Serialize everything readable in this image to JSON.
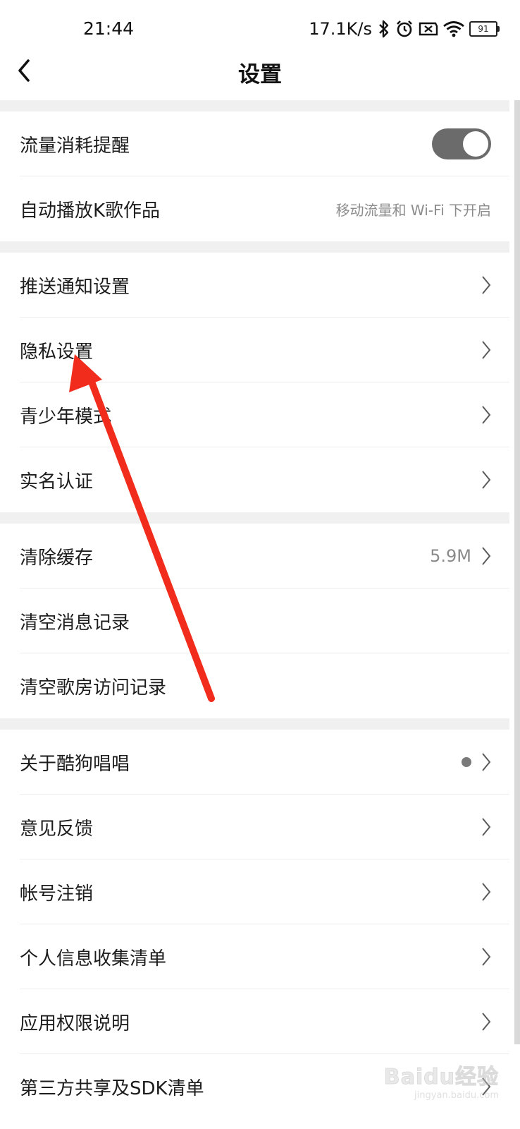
{
  "status_bar": {
    "time": "21:44",
    "network_speed": "17.1K/s",
    "battery_level": "91",
    "icons": [
      "bluetooth-icon",
      "alarm-icon",
      "sim-error-icon",
      "wifi-icon",
      "battery-icon"
    ]
  },
  "navbar": {
    "title": "设置",
    "back_icon": "chevron-left-icon"
  },
  "groups": [
    {
      "rows": [
        {
          "label": "流量消耗提醒",
          "control": "toggle",
          "toggle_on": true
        },
        {
          "label": "自动播放K歌作品",
          "value": "移动流量和 Wi-Fi 下开启"
        }
      ]
    },
    {
      "rows": [
        {
          "label": "推送通知设置"
        },
        {
          "label": "隐私设置"
        },
        {
          "label": "青少年模式"
        },
        {
          "label": "实名认证"
        }
      ]
    },
    {
      "rows": [
        {
          "label": "清除缓存",
          "value": "5.9M"
        },
        {
          "label": "清空消息记录"
        },
        {
          "label": "清空歌房访问记录"
        }
      ]
    },
    {
      "rows": [
        {
          "label": "关于酷狗唱唱",
          "badge": "dot"
        },
        {
          "label": "意见反馈"
        },
        {
          "label": "帐号注销"
        },
        {
          "label": "个人信息收集清单"
        },
        {
          "label": "应用权限说明"
        },
        {
          "label": "第三方共享及SDK清单"
        }
      ]
    }
  ],
  "annotation": {
    "color": "#f22c1c",
    "points_to": "隐私设置"
  },
  "watermark": {
    "main": "Baidu经验",
    "sub": "jingyan.baidu.com"
  },
  "colors": {
    "toggle_on": "#6b6b6b",
    "section_gap": "#f0f0f0",
    "secondary_text": "#8a8a8a"
  }
}
